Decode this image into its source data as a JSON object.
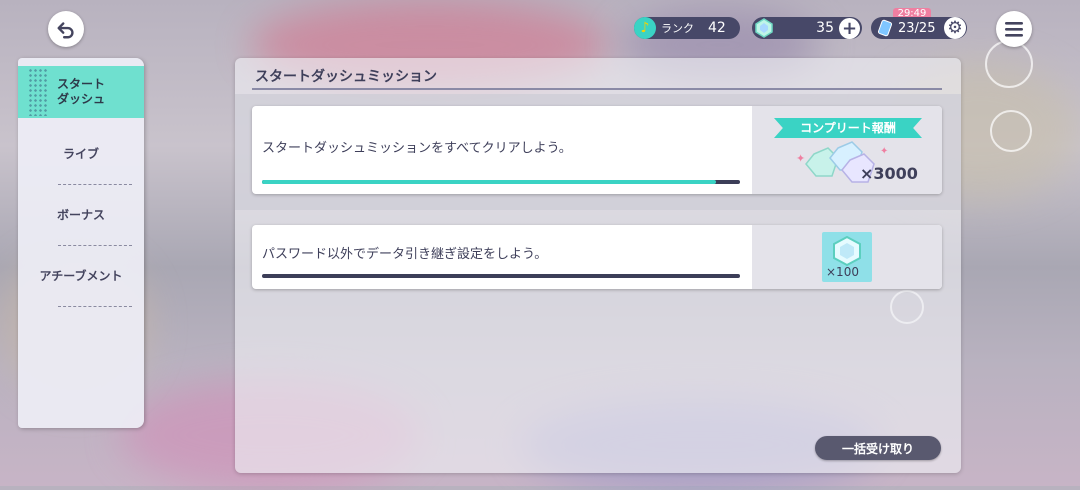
{
  "header": {
    "rank_label": "ランク",
    "rank_value": "42",
    "gems": "35",
    "timer": "29:49",
    "stamina": "23/25"
  },
  "sidebar": {
    "items": [
      {
        "label": "スタート\nダッシュ",
        "active": true
      },
      {
        "label": "ライブ",
        "active": false
      },
      {
        "label": "ボーナス",
        "active": false
      },
      {
        "label": "アチーブメント",
        "active": false
      }
    ]
  },
  "main": {
    "title": "スタートダッシュミッション",
    "complete_banner": {
      "label": "コンプリート報酬",
      "amount": "×3000"
    },
    "missions": [
      {
        "text": "スタートダッシュミッションをすべてクリアしよう。",
        "progress": 0.95
      },
      {
        "text": "パスワード以外でデータ引き継ぎ設定をしよう。",
        "progress": 0.0,
        "reward": "×100"
      }
    ],
    "claim_all": "一括受け取り"
  },
  "colors": {
    "accent": "#3ad3c4",
    "dark": "#474868",
    "active_tab": "#6fe0cf",
    "badge": "#ef7fa1"
  }
}
